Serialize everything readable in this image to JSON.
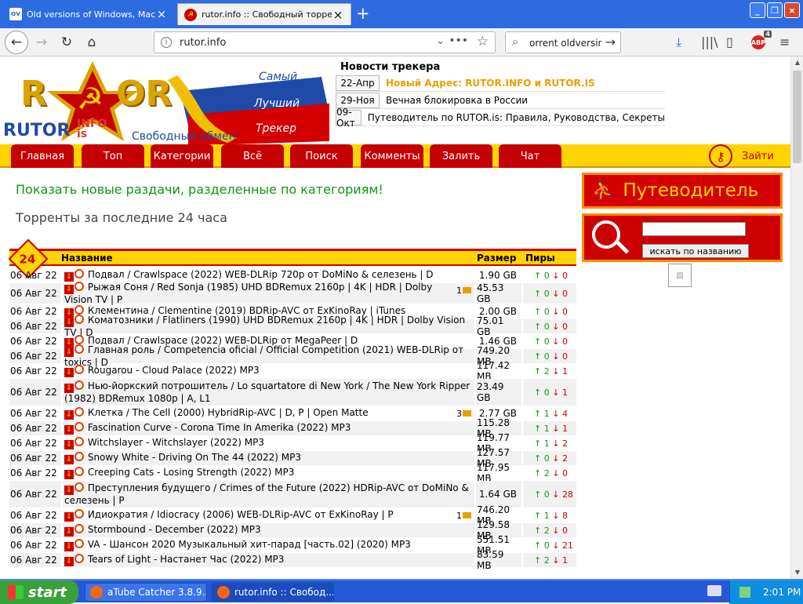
{
  "browser": {
    "tabs": [
      {
        "label": "Old versions of Windows, Mac and",
        "favicon": "ov"
      },
      {
        "label": "rutor.info :: Свободный торрент"
      }
    ],
    "url": "rutor.info",
    "search_value": "orrent oldversin",
    "abp_count": "4"
  },
  "site": {
    "logo_big_left": "R",
    "logo_big_right": "OR",
    "logo_small": "RUTOR",
    "logo_info": "INFO",
    "logo_is": "is",
    "logo_free": "Свободный обмен",
    "slogan": [
      "Самый",
      "Лучший",
      "Трекер"
    ],
    "news_title": "Новости трекера",
    "news": [
      {
        "date": "22-Апр",
        "text": "Новый Адрес: RUTOR.INFO и RUTOR.IS"
      },
      {
        "date": "29-Ноя",
        "text": "Вечная блокировка в России"
      },
      {
        "date": "09-Окт",
        "text": "Путеводитель по RUTOR.is: Правила, Руководства, Секреты"
      }
    ],
    "menu": [
      "Главная",
      "Топ",
      "Категории",
      "Всё",
      "Поиск",
      "Комменты",
      "Залить",
      "Чат"
    ],
    "login": "Зайти"
  },
  "main": {
    "show_new": "Показать новые раздачи, разделенные по категориям!",
    "last24": "Торренты за последние 24 часа",
    "badge": "24",
    "headers": {
      "name": "Название",
      "size": "Размер",
      "peers": "Пиры"
    },
    "rows": [
      {
        "date": "06 Авг 22",
        "title": "Подвал / Crawlspace (2022) WEB-DLRip 720p от DoMiNo & селезень | D",
        "comments": "",
        "size": "1.90 GB",
        "seed": "0",
        "leech": "0"
      },
      {
        "date": "06 Авг 22",
        "title": "Рыжая Соня / Red Sonja (1985) UHD BDRemux 2160p | 4K | HDR | Dolby Vision TV | P",
        "comments": "1",
        "size": "45.53 GB",
        "seed": "0",
        "leech": "0"
      },
      {
        "date": "06 Авг 22",
        "title": "Клементина / Clementine (2019) BDRip-AVC от ExKinoRay | iTunes",
        "comments": "",
        "size": "2.00 GB",
        "seed": "0",
        "leech": "0"
      },
      {
        "date": "06 Авг 22",
        "title": "Коматозники / Flatliners (1990) UHD BDRemux 2160p | 4K | HDR | Dolby Vision TV | D",
        "comments": "",
        "size": "75.01 GB",
        "seed": "0",
        "leech": "0"
      },
      {
        "date": "06 Авг 22",
        "title": "Подвал / Crawlspace (2022) WEB-DLRip от MegaPeer | D",
        "comments": "",
        "size": "1.46 GB",
        "seed": "0",
        "leech": "0"
      },
      {
        "date": "06 Авг 22",
        "title": "Главная роль / Competencia oficial / Official Competition (2021) WEB-DLRip от toxics | D",
        "comments": "",
        "size": "749.20 MB",
        "seed": "0",
        "leech": "0"
      },
      {
        "date": "06 Авг 22",
        "title": "Rougarou - Cloud Palace (2022) MP3",
        "comments": "",
        "size": "117.42 MB",
        "seed": "2",
        "leech": "1"
      },
      {
        "date": "06 Авг 22",
        "title": "Нью-йоркский потрошитель / Lo squartatore di New York / The New York Ripper (1982) BDRemux 1080p | A, L1",
        "comments": "",
        "size": "23.49 GB",
        "seed": "0",
        "leech": "1"
      },
      {
        "date": "06 Авг 22",
        "title": "Клетка / The Cell (2000) HybridRip-AVC | D, P | Open Matte",
        "comments": "3",
        "size": "2.77 GB",
        "seed": "1",
        "leech": "4"
      },
      {
        "date": "06 Авг 22",
        "title": "Fascination Curve - Corona Time In Amerika (2022) MP3",
        "comments": "",
        "size": "115.28 MB",
        "seed": "1",
        "leech": "1"
      },
      {
        "date": "06 Авг 22",
        "title": "Witchslayer - Witchslayer (2022) MP3",
        "comments": "",
        "size": "119.77 MB",
        "seed": "1",
        "leech": "2"
      },
      {
        "date": "06 Авг 22",
        "title": "Snowy White - Driving On The 44 (2022) MP3",
        "comments": "",
        "size": "127.57 MB",
        "seed": "0",
        "leech": "2"
      },
      {
        "date": "06 Авг 22",
        "title": "Creeping Cats - Losing Strength (2022) MP3",
        "comments": "",
        "size": "117.95 MB",
        "seed": "2",
        "leech": "0"
      },
      {
        "date": "06 Авг 22",
        "title": "Преступления будущего / Crimes of the Future (2022) HDRip-AVC от DoMiNo & селезень | P",
        "comments": "",
        "size": "1.64 GB",
        "seed": "0",
        "leech": "28"
      },
      {
        "date": "06 Авг 22",
        "title": "Идиократия / Idiocracy (2006) WEB-DLRip-AVC от ExKinoRay | P",
        "comments": "1",
        "size": "746.20 MB",
        "seed": "1",
        "leech": "8"
      },
      {
        "date": "06 Авг 22",
        "title": "Stormbound - December (2022) MP3",
        "comments": "",
        "size": "129.58 MB",
        "seed": "2",
        "leech": "0"
      },
      {
        "date": "06 Авг 22",
        "title": "VA - Шансон 2020 Музыкальный хит-парад [часть.02] (2020) MP3",
        "comments": "",
        "size": "551.51 MB",
        "seed": "0",
        "leech": "21"
      },
      {
        "date": "06 Авг 22",
        "title": "Tears of Light - Настанет Час (2022) MP3",
        "comments": "",
        "size": "83.59 MB",
        "seed": "2",
        "leech": "1"
      }
    ]
  },
  "sidebar": {
    "guide": "Путеводитель",
    "search_button": "искать по названию"
  },
  "taskbar": {
    "start": "start",
    "tasks": [
      "aTube Catcher 3.8.9...",
      "rutor.info :: Свобод..."
    ],
    "clock": "2:01 PM"
  },
  "colors": {
    "brand_red": "#c40000",
    "brand_yellow": "#ffd400",
    "link_green": "#0a9a0a",
    "xp_blue": "#2558d6"
  }
}
